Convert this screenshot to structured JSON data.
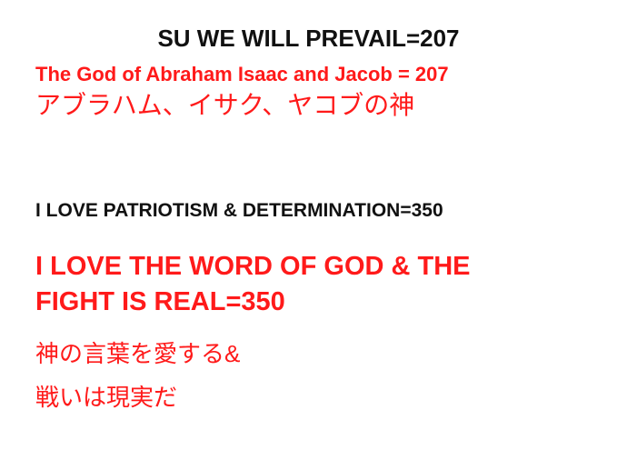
{
  "colors": {
    "black_text": "#111111",
    "red_text": "#ff1a1a",
    "background": "#ffffff"
  },
  "lines": {
    "line1": "SU WE WILL PREVAIL=207",
    "line2": "The God of Abraham Isaac and Jacob = 207",
    "line3": "アブラハム、イサク、ヤコブの神",
    "line4": "I LOVE PATRIOTISM & DETERMINATION=350",
    "line5": "I LOVE THE WORD OF GOD & THE",
    "line6": "FIGHT IS REAL=350",
    "line7": "神の言葉を愛する&",
    "line8": "戦いは現実だ"
  }
}
